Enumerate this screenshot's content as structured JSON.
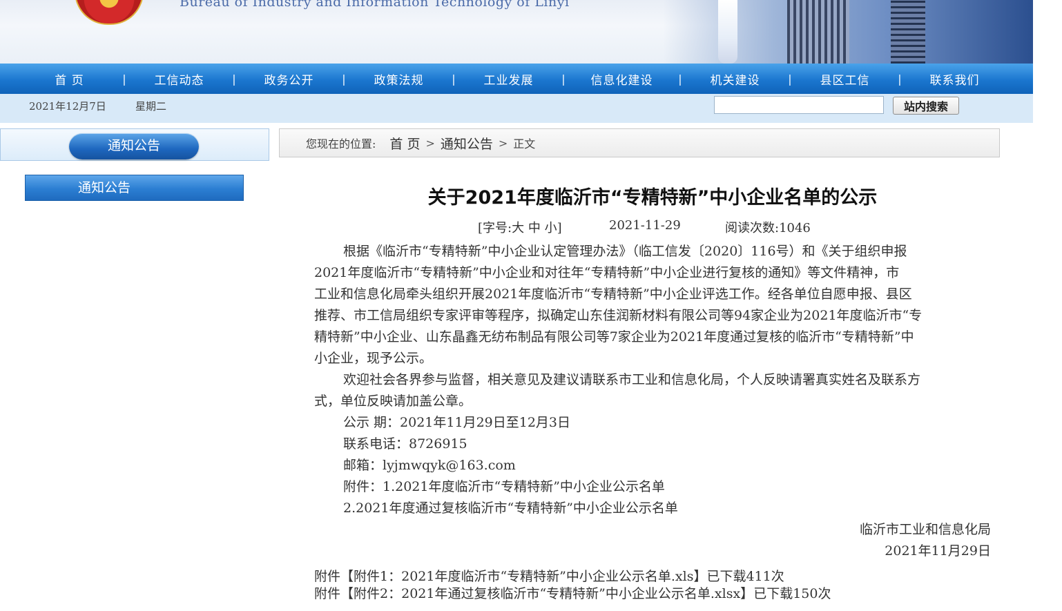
{
  "header": {
    "subtitle": "Bureau of Industry and Information Technology of Linyi"
  },
  "nav": {
    "items": [
      "首  页",
      "工信动态",
      "政务公开",
      "政策法规",
      "工业发展",
      "信息化建设",
      "机关建设",
      "县区工信",
      "联系我们"
    ],
    "separator": "|"
  },
  "infobar": {
    "date": "2021年12月7日",
    "weekday": "星期二",
    "search_value": "",
    "search_button": "站内搜索"
  },
  "sidebar": {
    "title": "通知公告",
    "items": [
      "通知公告"
    ]
  },
  "breadcrumb": {
    "label": "您现在的位置:",
    "home": "首  页",
    "section": "通知公告",
    "current": "正文",
    "arrow": ">"
  },
  "article": {
    "title": "关于2021年度临沂市“专精特新”中小企业名单的公示",
    "font_label_open": "[字号:",
    "font_large": "大",
    "font_medium": "中",
    "font_small": "小",
    "font_label_close": "]",
    "date": "2021-11-29",
    "views_label": "阅读次数:",
    "views": "1046",
    "lines": [
      "根据《临沂市“专精特新”中小企业认定管理办法》（临工信发〔2020〕116号）和《关于组织申报",
      "2021年度临沂市“专精特新”中小企业和对往年“专精特新”中小企业进行复核的通知》等文件精神，市",
      "工业和信息化局牵头组织开展2021年度临沂市“专精特新”中小企业评选工作。经各单位自愿申报、县区",
      "推荐、市工信局组织专家评审等程序，拟确定山东佳润新材料有限公司等94家企业为2021年度临沂市“专",
      "精特新”中小企业、山东晶鑫无纺布制品有限公司等7家企业为2021年度通过复核的临沂市“专精特新”中",
      "小企业，现予公示。",
      "欢迎社会各界参与监督，相关意见及建议请联系市工业和信息化局，个人反映请署真实姓名及联系方",
      "式，单位反映请加盖公章。",
      "公示 期：2021年11月29日至12月3日",
      "联系电话：8726915",
      "邮箱：lyjmwqyk@163.com",
      "附件：1.2021年度临沂市“专精特新”中小企业公示名单",
      "2.2021年度通过复核临沂市“专精特新”中小企业公示名单"
    ],
    "signature": "临沂市工业和信息化局",
    "sign_date": "2021年11月29日",
    "attachments": [
      {
        "prefix": "附件",
        "link": "【附件1：2021年度临沂市“专精特新”中小企业公示名单.xls】",
        "suffix": "已下载411次"
      },
      {
        "prefix": "附件",
        "link": "【附件2：2021年通过复核临沂市“专精特新”中小企业公示名单.xlsx】",
        "suffix": "已下载150次"
      }
    ]
  }
}
